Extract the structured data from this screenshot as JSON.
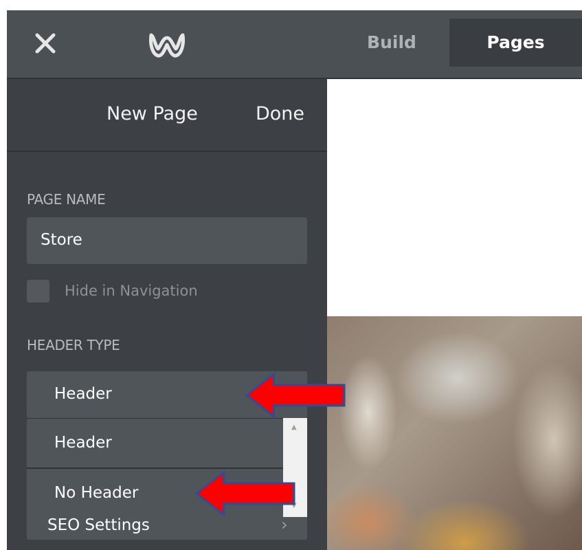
{
  "topbar": {
    "tabs": [
      {
        "label": "Build"
      },
      {
        "label": "Pages"
      }
    ]
  },
  "sidebar": {
    "new_page_label": "New Page",
    "done_label": "Done",
    "page_name_label": "PAGE NAME",
    "page_name_value": "Store",
    "hide_in_navigation_label": "Hide in Navigation",
    "header_type_label": "HEADER TYPE",
    "header_type_selected": "Header",
    "header_type_options": [
      "Header",
      "No Header"
    ],
    "seo_settings_label": "SEO Settings"
  },
  "colors": {
    "topbar": "#4b5055",
    "sidebar": "#3d4145",
    "field": "#50555a",
    "annotation_arrow": "#ff0000"
  },
  "icons": {
    "close": "close-icon",
    "logo": "weebly-logo-icon",
    "chevron": "chevron-right-icon"
  }
}
